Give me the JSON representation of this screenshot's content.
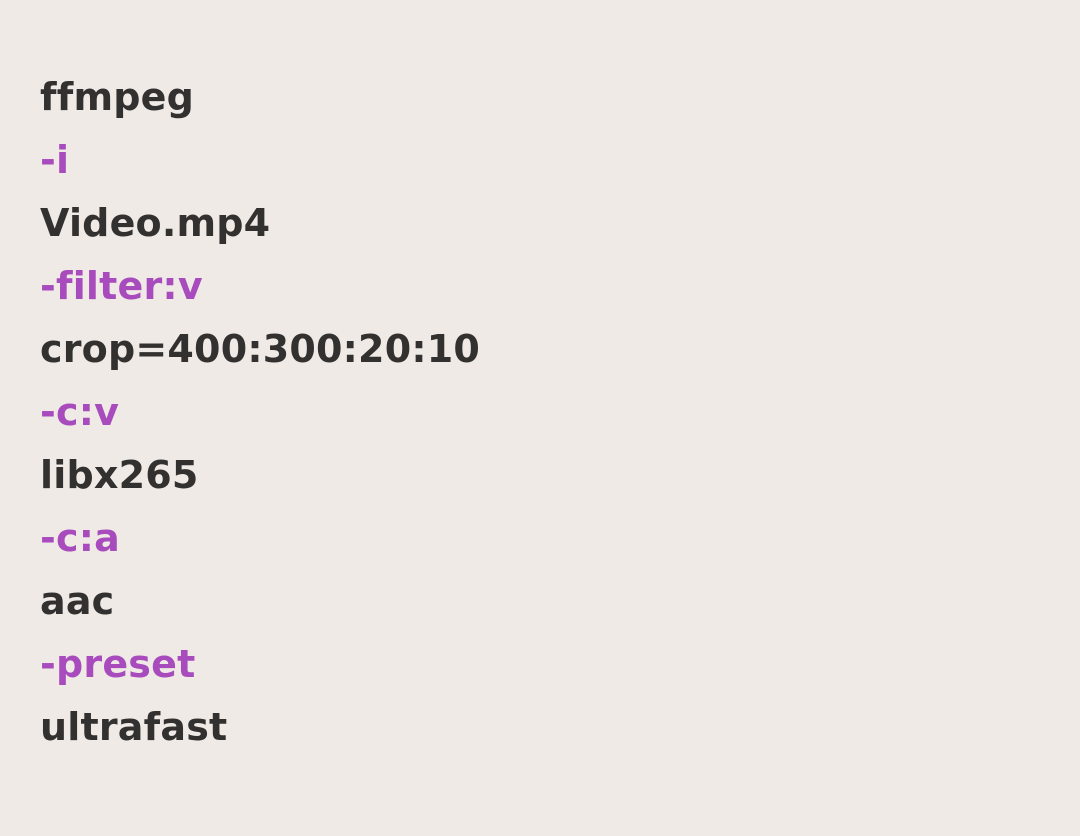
{
  "colors": {
    "background": "#efeae6",
    "text": "#333130",
    "flag": "#a84bbd"
  },
  "command_lines": [
    {
      "text": "ffmpeg",
      "kind": "cmd"
    },
    {
      "text": "-i",
      "kind": "flag"
    },
    {
      "text": "Video.mp4",
      "kind": "val"
    },
    {
      "text": "-filter:v",
      "kind": "flag"
    },
    {
      "text": "crop=400:300:20:10",
      "kind": "val"
    },
    {
      "text": "-c:v",
      "kind": "flag"
    },
    {
      "text": "libx265",
      "kind": "val"
    },
    {
      "text": "-c:a",
      "kind": "flag"
    },
    {
      "text": "aac",
      "kind": "val"
    },
    {
      "text": "-preset",
      "kind": "flag"
    },
    {
      "text": "ultrafast",
      "kind": "val"
    }
  ]
}
